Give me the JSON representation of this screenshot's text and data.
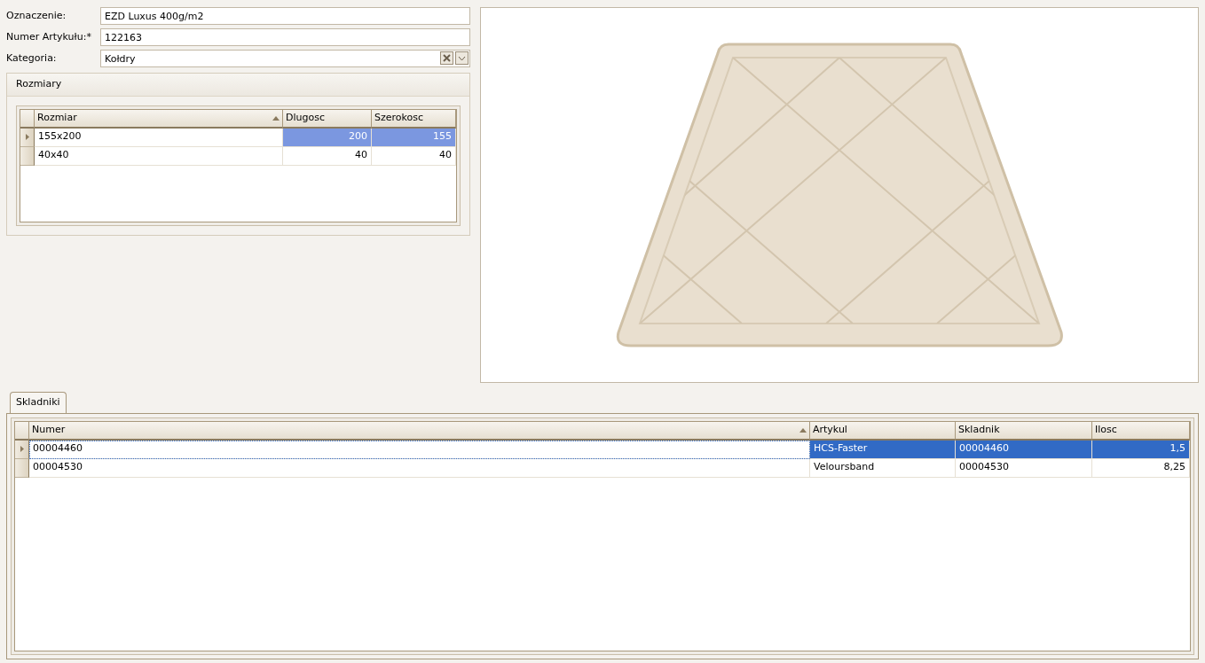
{
  "fields": [
    {
      "label": "Oznaczenie:",
      "value": "EZD Luxus 400g/m2",
      "kind": "text"
    },
    {
      "label": "Numer Artykułu:",
      "mark": "*",
      "value": "122163",
      "kind": "text"
    },
    {
      "label": "Kategoria:",
      "value": "Kołdry",
      "kind": "combo"
    }
  ],
  "sizes": {
    "title": "Rozmiary",
    "columns": [
      {
        "label": "Rozmiar",
        "sorted": true,
        "kind": "text"
      },
      {
        "label": "Dlugosc",
        "sorted": false,
        "kind": "number"
      },
      {
        "label": "Szerokosc",
        "sorted": false,
        "kind": "number"
      }
    ],
    "rows": [
      {
        "selected": true,
        "cells": [
          "155x200",
          "200",
          "155"
        ]
      },
      {
        "selected": false,
        "cells": [
          "40x40",
          "40",
          "40"
        ]
      }
    ]
  },
  "components": {
    "tabs": [
      {
        "label": "Skladniki",
        "selected": true
      }
    ],
    "columns": [
      {
        "label": "Numer",
        "sorted": true,
        "kind": "text"
      },
      {
        "label": "Artykul",
        "sorted": false,
        "kind": "text"
      },
      {
        "label": "Skladnik",
        "sorted": false,
        "kind": "text"
      },
      {
        "label": "Ilosc",
        "sorted": false,
        "kind": "number"
      }
    ],
    "rows": [
      {
        "selected": true,
        "cells": [
          "00004460",
          "HCS-Faster",
          "00004460",
          "1,5"
        ]
      },
      {
        "selected": false,
        "cells": [
          "00004530",
          "Veloursband",
          "00004530",
          "8,25"
        ]
      }
    ]
  }
}
